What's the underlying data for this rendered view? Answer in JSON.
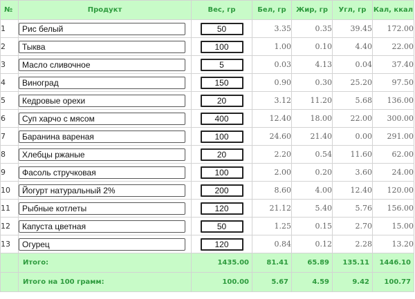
{
  "header": {
    "no": "№",
    "product": "Продукт",
    "weight": "Вес, гр",
    "protein": "Бел, гр",
    "fat": "Жир, гр",
    "carbs": "Угл, гр",
    "kcal": "Кал, ккал"
  },
  "rows": [
    {
      "no": "1",
      "product": "Рис белый",
      "weight": "50",
      "protein": "3.35",
      "fat": "0.35",
      "carbs": "39.45",
      "kcal": "172.00"
    },
    {
      "no": "2",
      "product": "Тыква",
      "weight": "100",
      "protein": "1.00",
      "fat": "0.10",
      "carbs": "4.40",
      "kcal": "22.00"
    },
    {
      "no": "3",
      "product": "Масло сливочное",
      "weight": "5",
      "protein": "0.03",
      "fat": "4.13",
      "carbs": "0.04",
      "kcal": "37.40"
    },
    {
      "no": "4",
      "product": "Виноград",
      "weight": "150",
      "protein": "0.90",
      "fat": "0.30",
      "carbs": "25.20",
      "kcal": "97.50"
    },
    {
      "no": "5",
      "product": "Кедровые орехи",
      "weight": "20",
      "protein": "3.12",
      "fat": "11.20",
      "carbs": "5.68",
      "kcal": "136.00"
    },
    {
      "no": "6",
      "product": "Суп харчо с мясом",
      "weight": "400",
      "protein": "12.40",
      "fat": "18.00",
      "carbs": "22.00",
      "kcal": "300.00"
    },
    {
      "no": "7",
      "product": "Баранина вареная",
      "weight": "100",
      "protein": "24.60",
      "fat": "21.40",
      "carbs": "0.00",
      "kcal": "291.00"
    },
    {
      "no": "8",
      "product": "Хлебцы ржаные",
      "weight": "20",
      "protein": "2.20",
      "fat": "0.54",
      "carbs": "11.60",
      "kcal": "62.00"
    },
    {
      "no": "9",
      "product": "Фасоль стручковая",
      "weight": "100",
      "protein": "2.00",
      "fat": "0.20",
      "carbs": "3.60",
      "kcal": "24.00"
    },
    {
      "no": "10",
      "product": "Йогурт натуральный 2%",
      "weight": "200",
      "protein": "8.60",
      "fat": "4.00",
      "carbs": "12.40",
      "kcal": "120.00"
    },
    {
      "no": "11",
      "product": "Рыбные котлеты",
      "weight": "120",
      "protein": "21.12",
      "fat": "5.40",
      "carbs": "5.76",
      "kcal": "156.00"
    },
    {
      "no": "12",
      "product": "Капуста цветная",
      "weight": "50",
      "protein": "1.25",
      "fat": "0.15",
      "carbs": "2.70",
      "kcal": "15.00"
    },
    {
      "no": "13",
      "product": "Огурец",
      "weight": "120",
      "protein": "0.84",
      "fat": "0.12",
      "carbs": "2.28",
      "kcal": "13.20"
    }
  ],
  "totals": {
    "label": "Итого:",
    "weight": "1435.00",
    "protein": "81.41",
    "fat": "65.89",
    "carbs": "135.11",
    "kcal": "1446.10"
  },
  "per100": {
    "label": "Итого на 100 грамм:",
    "weight": "100.00",
    "protein": "5.67",
    "fat": "4.59",
    "carbs": "9.42",
    "kcal": "100.77"
  },
  "colors": {
    "header_bg": "#c8fbc8",
    "header_text": "#2e9b3e",
    "border": "#d3d3d3",
    "number_text": "#666666"
  }
}
